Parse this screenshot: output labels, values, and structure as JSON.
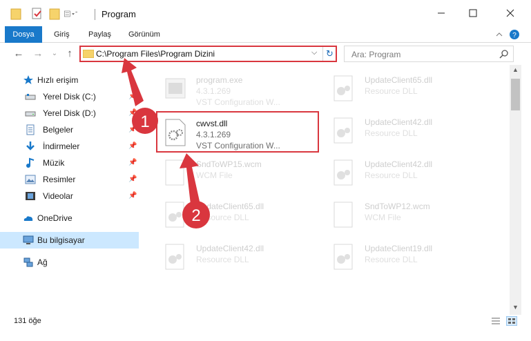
{
  "window": {
    "title": "Program",
    "minimize_icon": "minimize-icon",
    "maximize_icon": "maximize-icon",
    "close_icon": "close-icon"
  },
  "ribbon": {
    "tabs": [
      {
        "label": "Dosya",
        "active": true
      },
      {
        "label": "Giriş",
        "active": false
      },
      {
        "label": "Paylaş",
        "active": false
      },
      {
        "label": "Görünüm",
        "active": false
      }
    ]
  },
  "address": {
    "path": "C:\\Program Files\\Program Dizini"
  },
  "search": {
    "placeholder": "Ara: Program"
  },
  "sidebar": {
    "items": [
      {
        "label": "Hızlı erişim",
        "icon": "star-icon",
        "pinned": false
      },
      {
        "label": "Yerel Disk (C:)",
        "icon": "drive-icon",
        "pinned": true
      },
      {
        "label": "Yerel Disk (D:)",
        "icon": "drive-icon",
        "pinned": true
      },
      {
        "label": "Belgeler",
        "icon": "documents-icon",
        "pinned": true
      },
      {
        "label": "İndirmeler",
        "icon": "downloads-icon",
        "pinned": true
      },
      {
        "label": "Müzik",
        "icon": "music-icon",
        "pinned": true
      },
      {
        "label": "Resimler",
        "icon": "pictures-icon",
        "pinned": true
      },
      {
        "label": "Videolar",
        "icon": "videos-icon",
        "pinned": true
      },
      {
        "label": "OneDrive",
        "icon": "onedrive-icon",
        "pinned": false
      },
      {
        "label": "Bu bilgisayar",
        "icon": "computer-icon",
        "pinned": false,
        "selected": true
      },
      {
        "label": "Ağ",
        "icon": "network-icon",
        "pinned": false
      }
    ]
  },
  "files": [
    {
      "name": "program.exe",
      "version": "4.3.1.269",
      "type": "VST Configuration W...",
      "faded": true
    },
    {
      "name": "UpdateClient65.dll",
      "version": "",
      "type": "Resource DLL",
      "faded": true
    },
    {
      "name": "cwvst.dll",
      "version": "4.3.1.269",
      "type": "VST Configuration W...",
      "faded": false,
      "highlight": true
    },
    {
      "name": "UpdateClient42.dll",
      "version": "",
      "type": "Resource DLL",
      "faded": true
    },
    {
      "name": "SndToWP15.wcm",
      "version": "",
      "type": "WCM File",
      "faded": true
    },
    {
      "name": "UpdateClient42.dll",
      "version": "",
      "type": "Resource DLL",
      "faded": true
    },
    {
      "name": "UpdateClient65.dll",
      "version": "",
      "type": "Resource DLL",
      "faded": true
    },
    {
      "name": "SndToWP12.wcm",
      "version": "",
      "type": "WCM File",
      "faded": true
    },
    {
      "name": "UpdateClient42.dll",
      "version": "",
      "type": "Resource DLL",
      "faded": true
    },
    {
      "name": "UpdateClient19.dll",
      "version": "",
      "type": "Resource DLL",
      "faded": true
    }
  ],
  "status": {
    "item_count": "131 öğe"
  },
  "annotations": {
    "step1": "1",
    "step2": "2",
    "color": "#d9363e"
  }
}
